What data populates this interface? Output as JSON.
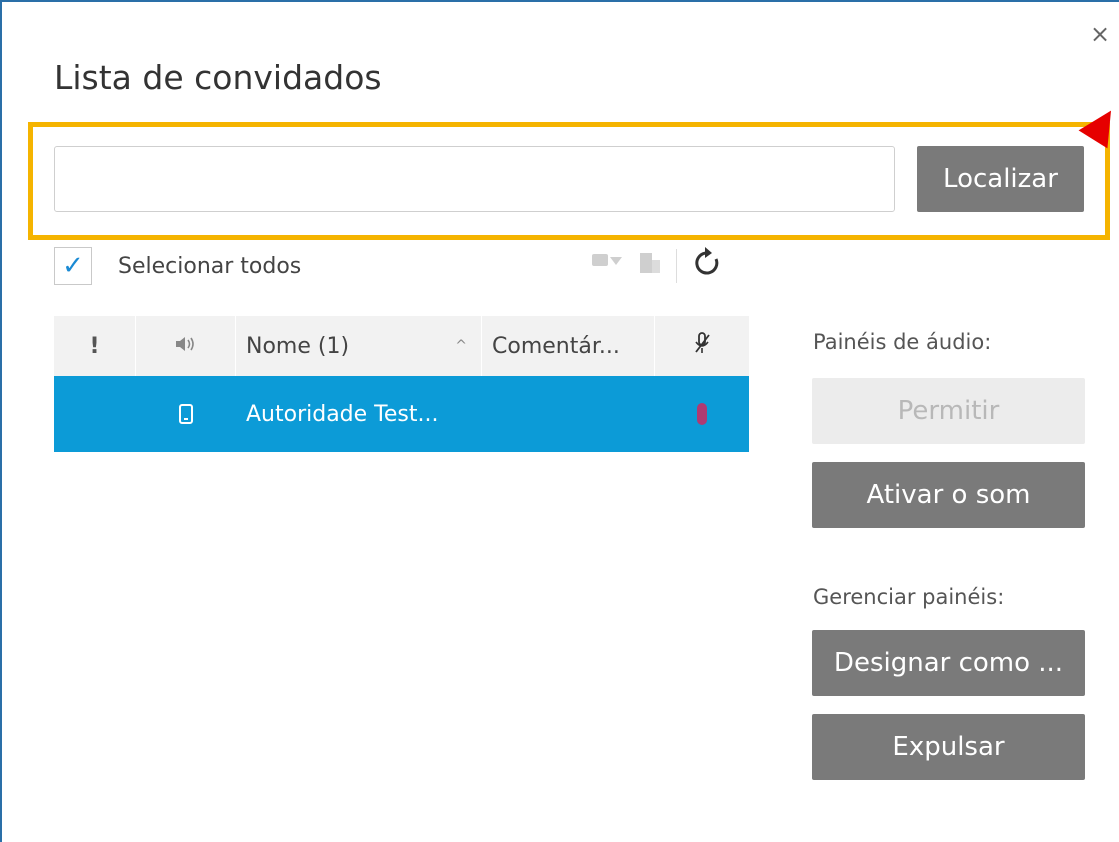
{
  "dialog": {
    "title": "Lista de convidados",
    "close_glyph": "×"
  },
  "search": {
    "value": "",
    "placeholder": "",
    "button_label": "Localizar"
  },
  "select_all": {
    "label": "Selecionar todos",
    "checked": true
  },
  "toolbar": {
    "icons": [
      "video-filter-icon",
      "building-icon",
      "refresh-icon"
    ]
  },
  "table": {
    "columns": [
      {
        "key": "alert",
        "label": "!"
      },
      {
        "key": "audio",
        "label": "🔈"
      },
      {
        "key": "name",
        "label": "Nome (1)"
      },
      {
        "key": "comment",
        "label": "Comentár..."
      },
      {
        "key": "mic",
        "label": ""
      }
    ],
    "rows": [
      {
        "alert": "",
        "device_icon": "phone-icon",
        "name": "Autoridade Test...",
        "comment": "",
        "mic_icon": "mic-muted-icon"
      }
    ]
  },
  "side_panel": {
    "audio_label": "Painéis de áudio:",
    "allow_label": "Permitir",
    "activate_sound_label": "Ativar o som",
    "manage_label": "Gerenciar painéis:",
    "designate_label": "Designar como ...",
    "expel_label": "Expulsar"
  },
  "colors": {
    "accent_row": "#0c9bd7",
    "highlight_border": "#f5b400",
    "arrow": "#e60000",
    "button": "#7a7a7a"
  }
}
